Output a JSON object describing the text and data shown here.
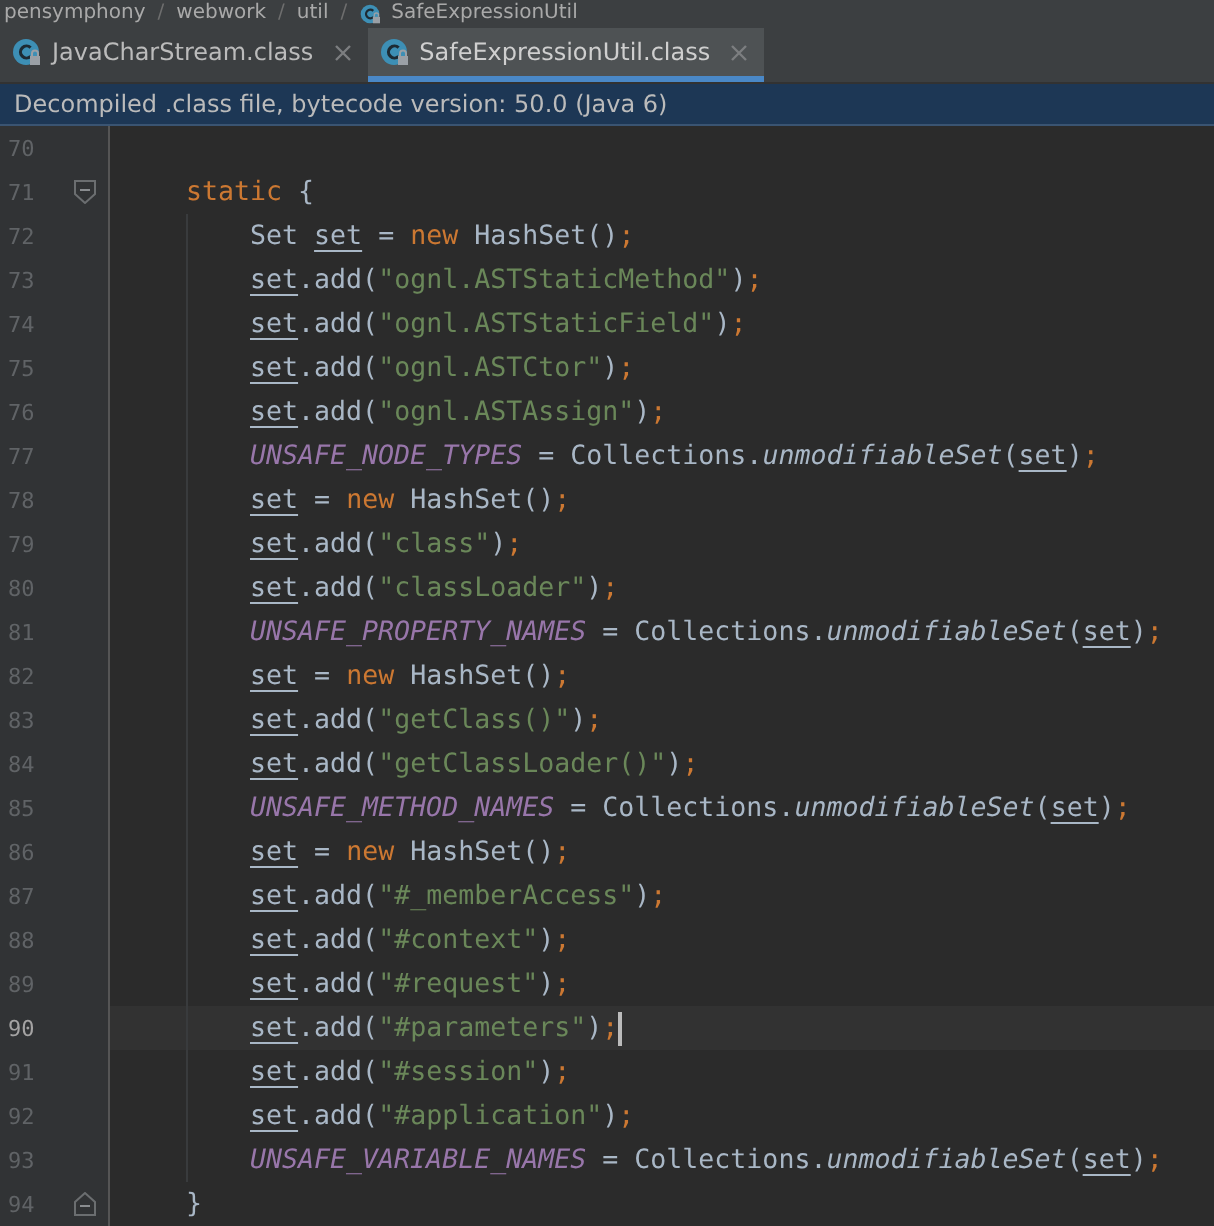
{
  "breadcrumb": [
    {
      "label": "pensymphony",
      "icon": false
    },
    {
      "separator": "/",
      "label": "webwork",
      "icon": false
    },
    {
      "separator": "/",
      "label": "util",
      "icon": false
    },
    {
      "separator": "/",
      "label": "SafeExpressionUtil",
      "icon": true
    }
  ],
  "tabs": [
    {
      "label": "JavaCharStream.class",
      "selected": false
    },
    {
      "label": "SafeExpressionUtil.class",
      "selected": true
    }
  ],
  "banner": "Decompiled .class file, bytecode version: 50.0 (Java 6)",
  "lines": [
    {
      "number": "70",
      "kind": "code",
      "current": false
    },
    {
      "number": "71",
      "kind": "fold-start",
      "current": false,
      "tokens": [
        {
          "kind": "keyword",
          "text": "static"
        },
        {
          "kind": "plain",
          "text": " {"
        }
      ],
      "children": [
        {
          "number": "72",
          "kind": "code",
          "current": false,
          "tokens": [
            {
              "kind": "plain",
              "text": "Set "
            },
            {
              "kind": "local",
              "text": "set"
            },
            {
              "kind": "plain",
              "text": " = "
            },
            {
              "kind": "keyword",
              "text": "new"
            },
            {
              "kind": "plain",
              "text": " HashSet()"
            },
            {
              "kind": "keyword",
              "text": ";"
            }
          ]
        },
        {
          "number": "73",
          "kind": "code",
          "current": false,
          "tokens": [
            {
              "kind": "local",
              "text": "set"
            },
            {
              "kind": "plain",
              "text": ".add("
            },
            {
              "kind": "string",
              "text": "\"ognl.ASTStaticMethod\""
            },
            {
              "kind": "plain",
              "text": ")"
            },
            {
              "kind": "keyword",
              "text": ";"
            }
          ]
        },
        {
          "number": "74",
          "kind": "code",
          "current": false,
          "tokens": [
            {
              "kind": "local",
              "text": "set"
            },
            {
              "kind": "plain",
              "text": ".add("
            },
            {
              "kind": "string",
              "text": "\"ognl.ASTStaticField\""
            },
            {
              "kind": "plain",
              "text": ")"
            },
            {
              "kind": "keyword",
              "text": ";"
            }
          ]
        },
        {
          "number": "75",
          "kind": "code",
          "current": false,
          "tokens": [
            {
              "kind": "local",
              "text": "set"
            },
            {
              "kind": "plain",
              "text": ".add("
            },
            {
              "kind": "string",
              "text": "\"ognl.ASTCtor\""
            },
            {
              "kind": "plain",
              "text": ")"
            },
            {
              "kind": "keyword",
              "text": ";"
            }
          ]
        },
        {
          "number": "76",
          "kind": "code",
          "current": false,
          "tokens": [
            {
              "kind": "local",
              "text": "set"
            },
            {
              "kind": "plain",
              "text": ".add("
            },
            {
              "kind": "string",
              "text": "\"ognl.ASTAssign\""
            },
            {
              "kind": "plain",
              "text": ")"
            },
            {
              "kind": "keyword",
              "text": ";"
            }
          ]
        },
        {
          "number": "77",
          "kind": "code",
          "current": false,
          "tokens": [
            {
              "kind": "field",
              "text": "UNSAFE_NODE_TYPES"
            },
            {
              "kind": "plain",
              "text": " = Collections."
            },
            {
              "kind": "static-call",
              "text": "unmodifiableSet"
            },
            {
              "kind": "plain",
              "text": "("
            },
            {
              "kind": "local",
              "text": "set"
            },
            {
              "kind": "plain",
              "text": ")"
            },
            {
              "kind": "keyword",
              "text": ";"
            }
          ]
        },
        {
          "number": "78",
          "kind": "code",
          "current": false,
          "tokens": [
            {
              "kind": "local",
              "text": "set"
            },
            {
              "kind": "plain",
              "text": " = "
            },
            {
              "kind": "keyword",
              "text": "new"
            },
            {
              "kind": "plain",
              "text": " HashSet()"
            },
            {
              "kind": "keyword",
              "text": ";"
            }
          ]
        },
        {
          "number": "79",
          "kind": "code",
          "current": false,
          "tokens": [
            {
              "kind": "local",
              "text": "set"
            },
            {
              "kind": "plain",
              "text": ".add("
            },
            {
              "kind": "string",
              "text": "\"class\""
            },
            {
              "kind": "plain",
              "text": ")"
            },
            {
              "kind": "keyword",
              "text": ";"
            }
          ]
        },
        {
          "number": "80",
          "kind": "code",
          "current": false,
          "tokens": [
            {
              "kind": "local",
              "text": "set"
            },
            {
              "kind": "plain",
              "text": ".add("
            },
            {
              "kind": "string",
              "text": "\"classLoader\""
            },
            {
              "kind": "plain",
              "text": ")"
            },
            {
              "kind": "keyword",
              "text": ";"
            }
          ]
        },
        {
          "number": "81",
          "kind": "code",
          "current": false,
          "tokens": [
            {
              "kind": "field",
              "text": "UNSAFE_PROPERTY_NAMES"
            },
            {
              "kind": "plain",
              "text": " = Collections."
            },
            {
              "kind": "static-call",
              "text": "unmodifiableSet"
            },
            {
              "kind": "plain",
              "text": "("
            },
            {
              "kind": "local",
              "text": "set"
            },
            {
              "kind": "plain",
              "text": ")"
            },
            {
              "kind": "keyword",
              "text": ";"
            }
          ]
        },
        {
          "number": "82",
          "kind": "code",
          "current": false,
          "tokens": [
            {
              "kind": "local",
              "text": "set"
            },
            {
              "kind": "plain",
              "text": " = "
            },
            {
              "kind": "keyword",
              "text": "new"
            },
            {
              "kind": "plain",
              "text": " HashSet()"
            },
            {
              "kind": "keyword",
              "text": ";"
            }
          ]
        },
        {
          "number": "83",
          "kind": "code",
          "current": false,
          "tokens": [
            {
              "kind": "local",
              "text": "set"
            },
            {
              "kind": "plain",
              "text": ".add("
            },
            {
              "kind": "string",
              "text": "\"getClass()\""
            },
            {
              "kind": "plain",
              "text": ")"
            },
            {
              "kind": "keyword",
              "text": ";"
            }
          ]
        },
        {
          "number": "84",
          "kind": "code",
          "current": false,
          "tokens": [
            {
              "kind": "local",
              "text": "set"
            },
            {
              "kind": "plain",
              "text": ".add("
            },
            {
              "kind": "string",
              "text": "\"getClassLoader()\""
            },
            {
              "kind": "plain",
              "text": ")"
            },
            {
              "kind": "keyword",
              "text": ";"
            }
          ]
        },
        {
          "number": "85",
          "kind": "code",
          "current": false,
          "tokens": [
            {
              "kind": "field",
              "text": "UNSAFE_METHOD_NAMES"
            },
            {
              "kind": "plain",
              "text": " = Collections."
            },
            {
              "kind": "static-call",
              "text": "unmodifiableSet"
            },
            {
              "kind": "plain",
              "text": "("
            },
            {
              "kind": "local",
              "text": "set"
            },
            {
              "kind": "plain",
              "text": ")"
            },
            {
              "kind": "keyword",
              "text": ";"
            }
          ]
        },
        {
          "number": "86",
          "kind": "code",
          "current": false,
          "tokens": [
            {
              "kind": "local",
              "text": "set"
            },
            {
              "kind": "plain",
              "text": " = "
            },
            {
              "kind": "keyword",
              "text": "new"
            },
            {
              "kind": "plain",
              "text": " HashSet()"
            },
            {
              "kind": "keyword",
              "text": ";"
            }
          ]
        },
        {
          "number": "87",
          "kind": "code",
          "current": false,
          "tokens": [
            {
              "kind": "local",
              "text": "set"
            },
            {
              "kind": "plain",
              "text": ".add("
            },
            {
              "kind": "string",
              "text": "\"#_memberAccess\""
            },
            {
              "kind": "plain",
              "text": ")"
            },
            {
              "kind": "keyword",
              "text": ";"
            }
          ]
        },
        {
          "number": "88",
          "kind": "code",
          "current": false,
          "tokens": [
            {
              "kind": "local",
              "text": "set"
            },
            {
              "kind": "plain",
              "text": ".add("
            },
            {
              "kind": "string",
              "text": "\"#context\""
            },
            {
              "kind": "plain",
              "text": ")"
            },
            {
              "kind": "keyword",
              "text": ";"
            }
          ]
        },
        {
          "number": "89",
          "kind": "code",
          "current": false,
          "tokens": [
            {
              "kind": "local",
              "text": "set"
            },
            {
              "kind": "plain",
              "text": ".add("
            },
            {
              "kind": "string",
              "text": "\"#request\""
            },
            {
              "kind": "plain",
              "text": ")"
            },
            {
              "kind": "keyword",
              "text": ";"
            }
          ]
        },
        {
          "number": "90",
          "kind": "code",
          "current": true,
          "tokens": [
            {
              "kind": "local",
              "text": "set"
            },
            {
              "kind": "plain",
              "text": ".add("
            },
            {
              "kind": "string",
              "text": "\"#parameters\""
            },
            {
              "kind": "plain",
              "text": ")"
            },
            {
              "kind": "keyword",
              "text": ";"
            }
          ]
        },
        {
          "number": "91",
          "kind": "code",
          "current": false,
          "tokens": [
            {
              "kind": "local",
              "text": "set"
            },
            {
              "kind": "plain",
              "text": ".add("
            },
            {
              "kind": "string",
              "text": "\"#session\""
            },
            {
              "kind": "plain",
              "text": ")"
            },
            {
              "kind": "keyword",
              "text": ";"
            }
          ]
        },
        {
          "number": "92",
          "kind": "code",
          "current": false,
          "tokens": [
            {
              "kind": "local",
              "text": "set"
            },
            {
              "kind": "plain",
              "text": ".add("
            },
            {
              "kind": "string",
              "text": "\"#application\""
            },
            {
              "kind": "plain",
              "text": ")"
            },
            {
              "kind": "keyword",
              "text": ";"
            }
          ]
        },
        {
          "number": "93",
          "kind": "code",
          "current": false,
          "tokens": [
            {
              "kind": "field",
              "text": "UNSAFE_VARIABLE_NAMES"
            },
            {
              "kind": "plain",
              "text": " = Collections."
            },
            {
              "kind": "static-call",
              "text": "unmodifiableSet"
            },
            {
              "kind": "plain",
              "text": "("
            },
            {
              "kind": "local",
              "text": "set"
            },
            {
              "kind": "plain",
              "text": ")"
            },
            {
              "kind": "keyword",
              "text": ";"
            }
          ]
        }
      ]
    },
    {
      "number": "94",
      "kind": "fold-end",
      "current": false,
      "tokens": [
        {
          "kind": "plain",
          "text": "}"
        }
      ]
    }
  ]
}
